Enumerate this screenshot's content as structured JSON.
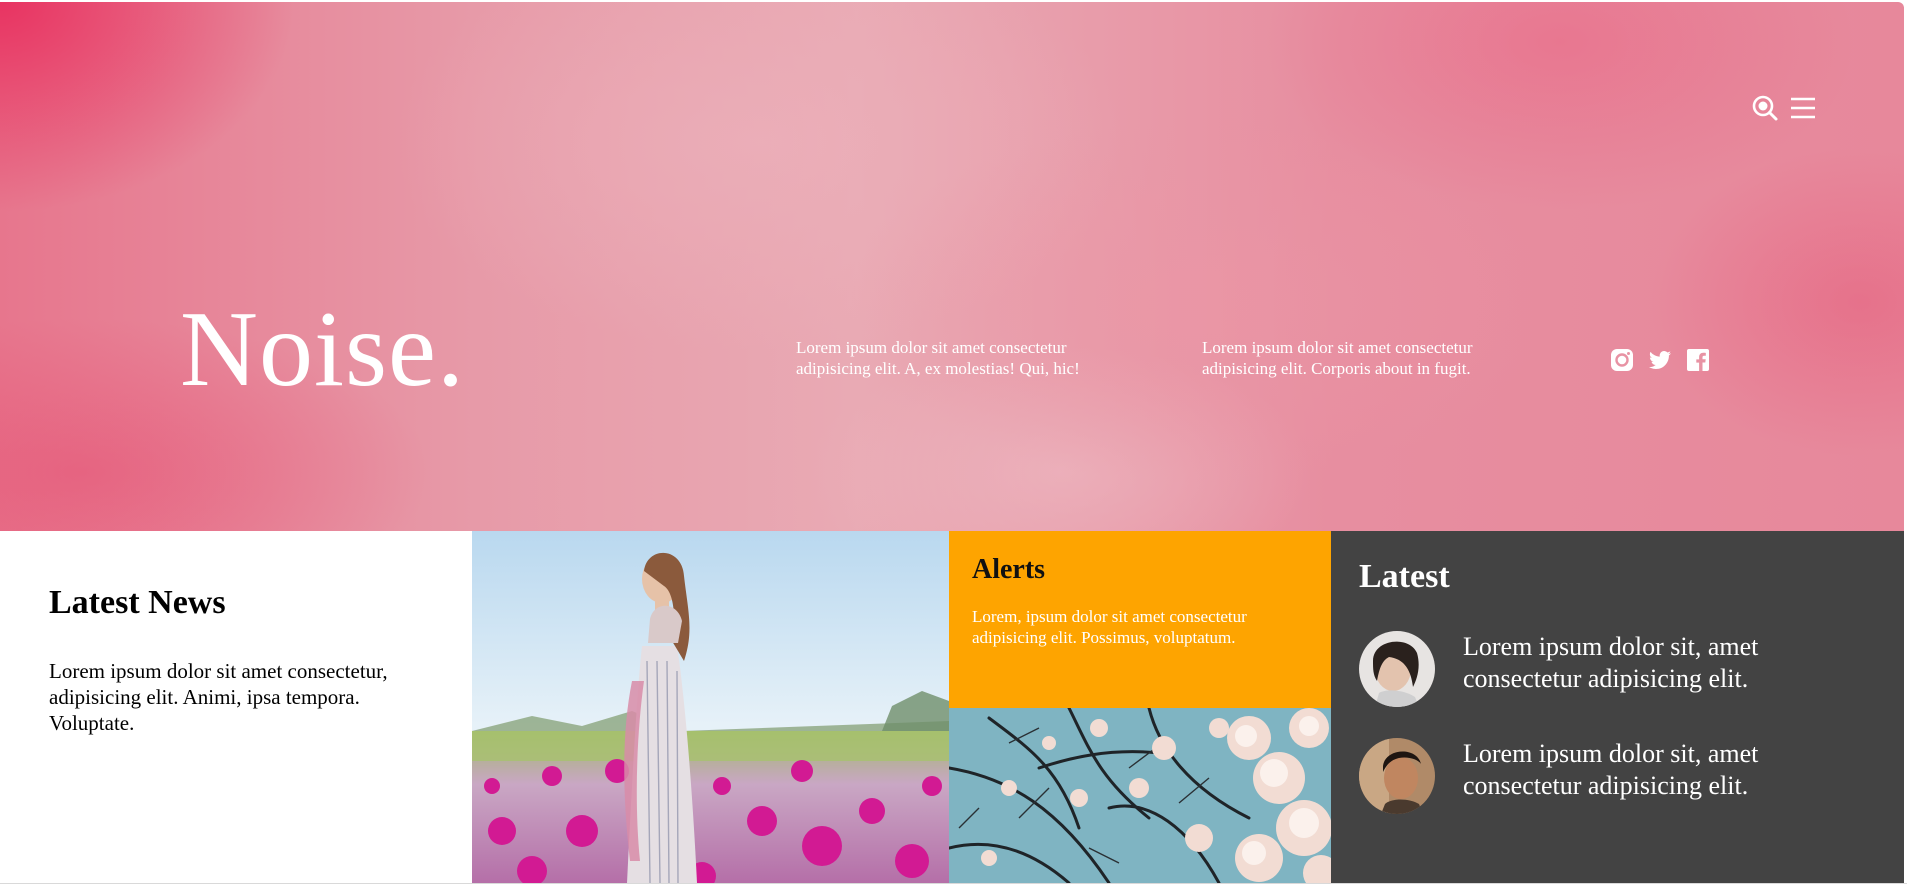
{
  "header": {
    "brand": "Noise.",
    "icons": [
      "search-icon",
      "menu-icon"
    ],
    "blurbs": [
      "Lorem ipsum dolor sit amet consectetur adipisicing elit. A, ex molestias! Qui, hic!",
      "Lorem ipsum dolor sit amet consectetur adipisicing elit. Corporis about in fugit."
    ],
    "socials": [
      "instagram-icon",
      "twitter-icon",
      "facebook-icon"
    ]
  },
  "news": {
    "title": "Latest News",
    "body": "Lorem ipsum dolor sit amet consectetur, adipisicing elit. Animi, ipsa tempora. Voluptate."
  },
  "alerts": {
    "title": "Alerts",
    "body": "Lorem, ipsum dolor sit amet consectetur adipisicing elit. Possimus, voluptatum."
  },
  "latest": {
    "title": "Latest",
    "items": [
      {
        "text": "Lorem ipsum dolor sit, amet consectetur adipisicing elit."
      },
      {
        "text": "Lorem ipsum dolor sit, amet consectetur adipisicing elit."
      }
    ]
  },
  "colors": {
    "hero": "#e7889b",
    "alerts": "#fea400",
    "latest": "#434343"
  }
}
